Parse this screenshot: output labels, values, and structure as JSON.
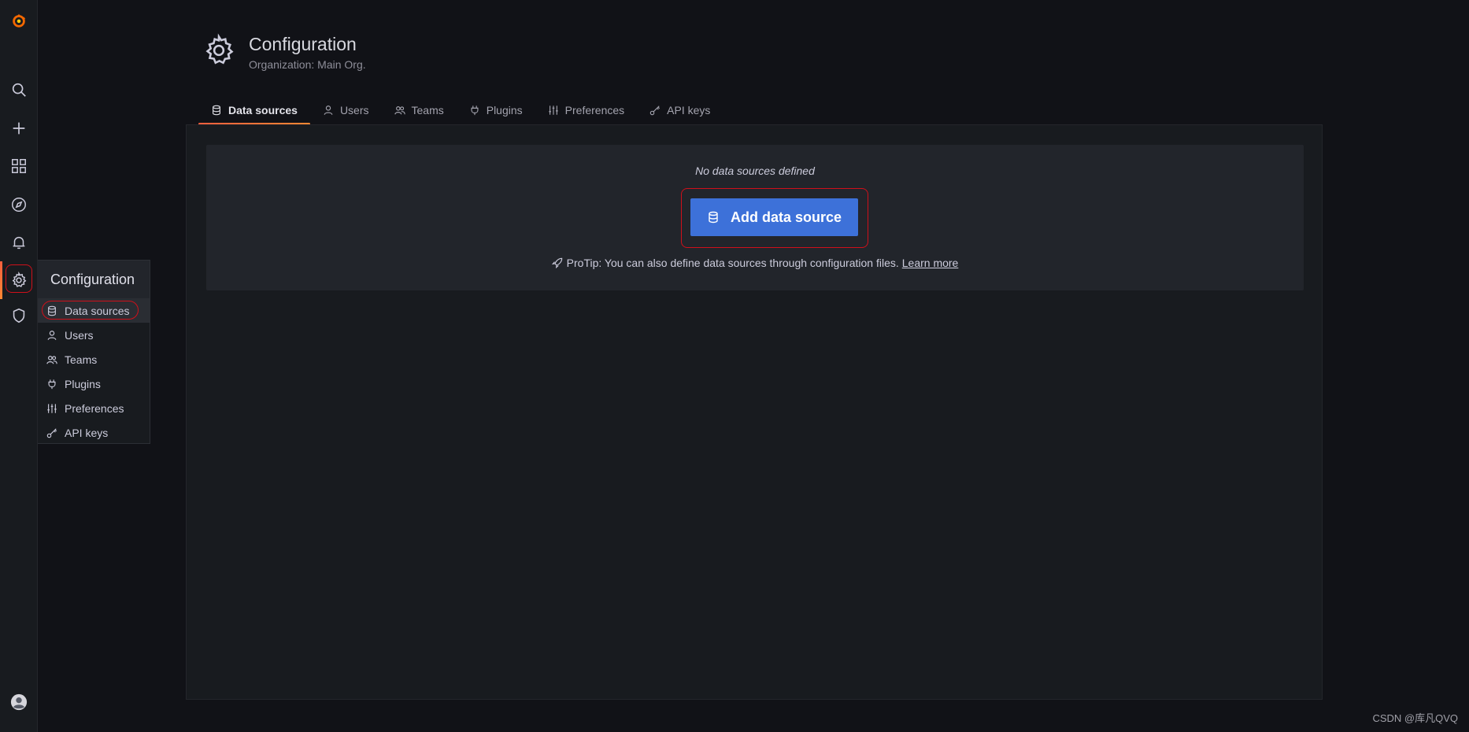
{
  "sidebar": {
    "icons": [
      "grafana-logo-icon",
      "search-icon",
      "plus-icon",
      "dashboards-icon",
      "explore-icon",
      "alert-bell-icon",
      "gear-icon",
      "shield-icon",
      "user-avatar-icon"
    ]
  },
  "flyout": {
    "title": "Configuration",
    "items": [
      {
        "label": "Data sources",
        "icon": "database-icon"
      },
      {
        "label": "Users",
        "icon": "user-icon"
      },
      {
        "label": "Teams",
        "icon": "users-icon"
      },
      {
        "label": "Plugins",
        "icon": "plug-icon"
      },
      {
        "label": "Preferences",
        "icon": "sliders-icon"
      },
      {
        "label": "API keys",
        "icon": "key-icon"
      }
    ]
  },
  "header": {
    "title": "Configuration",
    "subtitle": "Organization: Main Org."
  },
  "tabs": [
    {
      "label": "Data sources",
      "active": true
    },
    {
      "label": "Users"
    },
    {
      "label": "Teams"
    },
    {
      "label": "Plugins"
    },
    {
      "label": "Preferences"
    },
    {
      "label": "API keys"
    }
  ],
  "empty_state": {
    "message": "No data sources defined",
    "button_label": "Add data source",
    "protip": "ProTip: You can also define data sources through configuration files.",
    "learn_more": "Learn more"
  },
  "watermark": "CSDN @库凡QVQ",
  "colors": {
    "accent": "#3d71d9",
    "active_bar": "#f55f3e",
    "highlight_ring": "#d0101a"
  }
}
